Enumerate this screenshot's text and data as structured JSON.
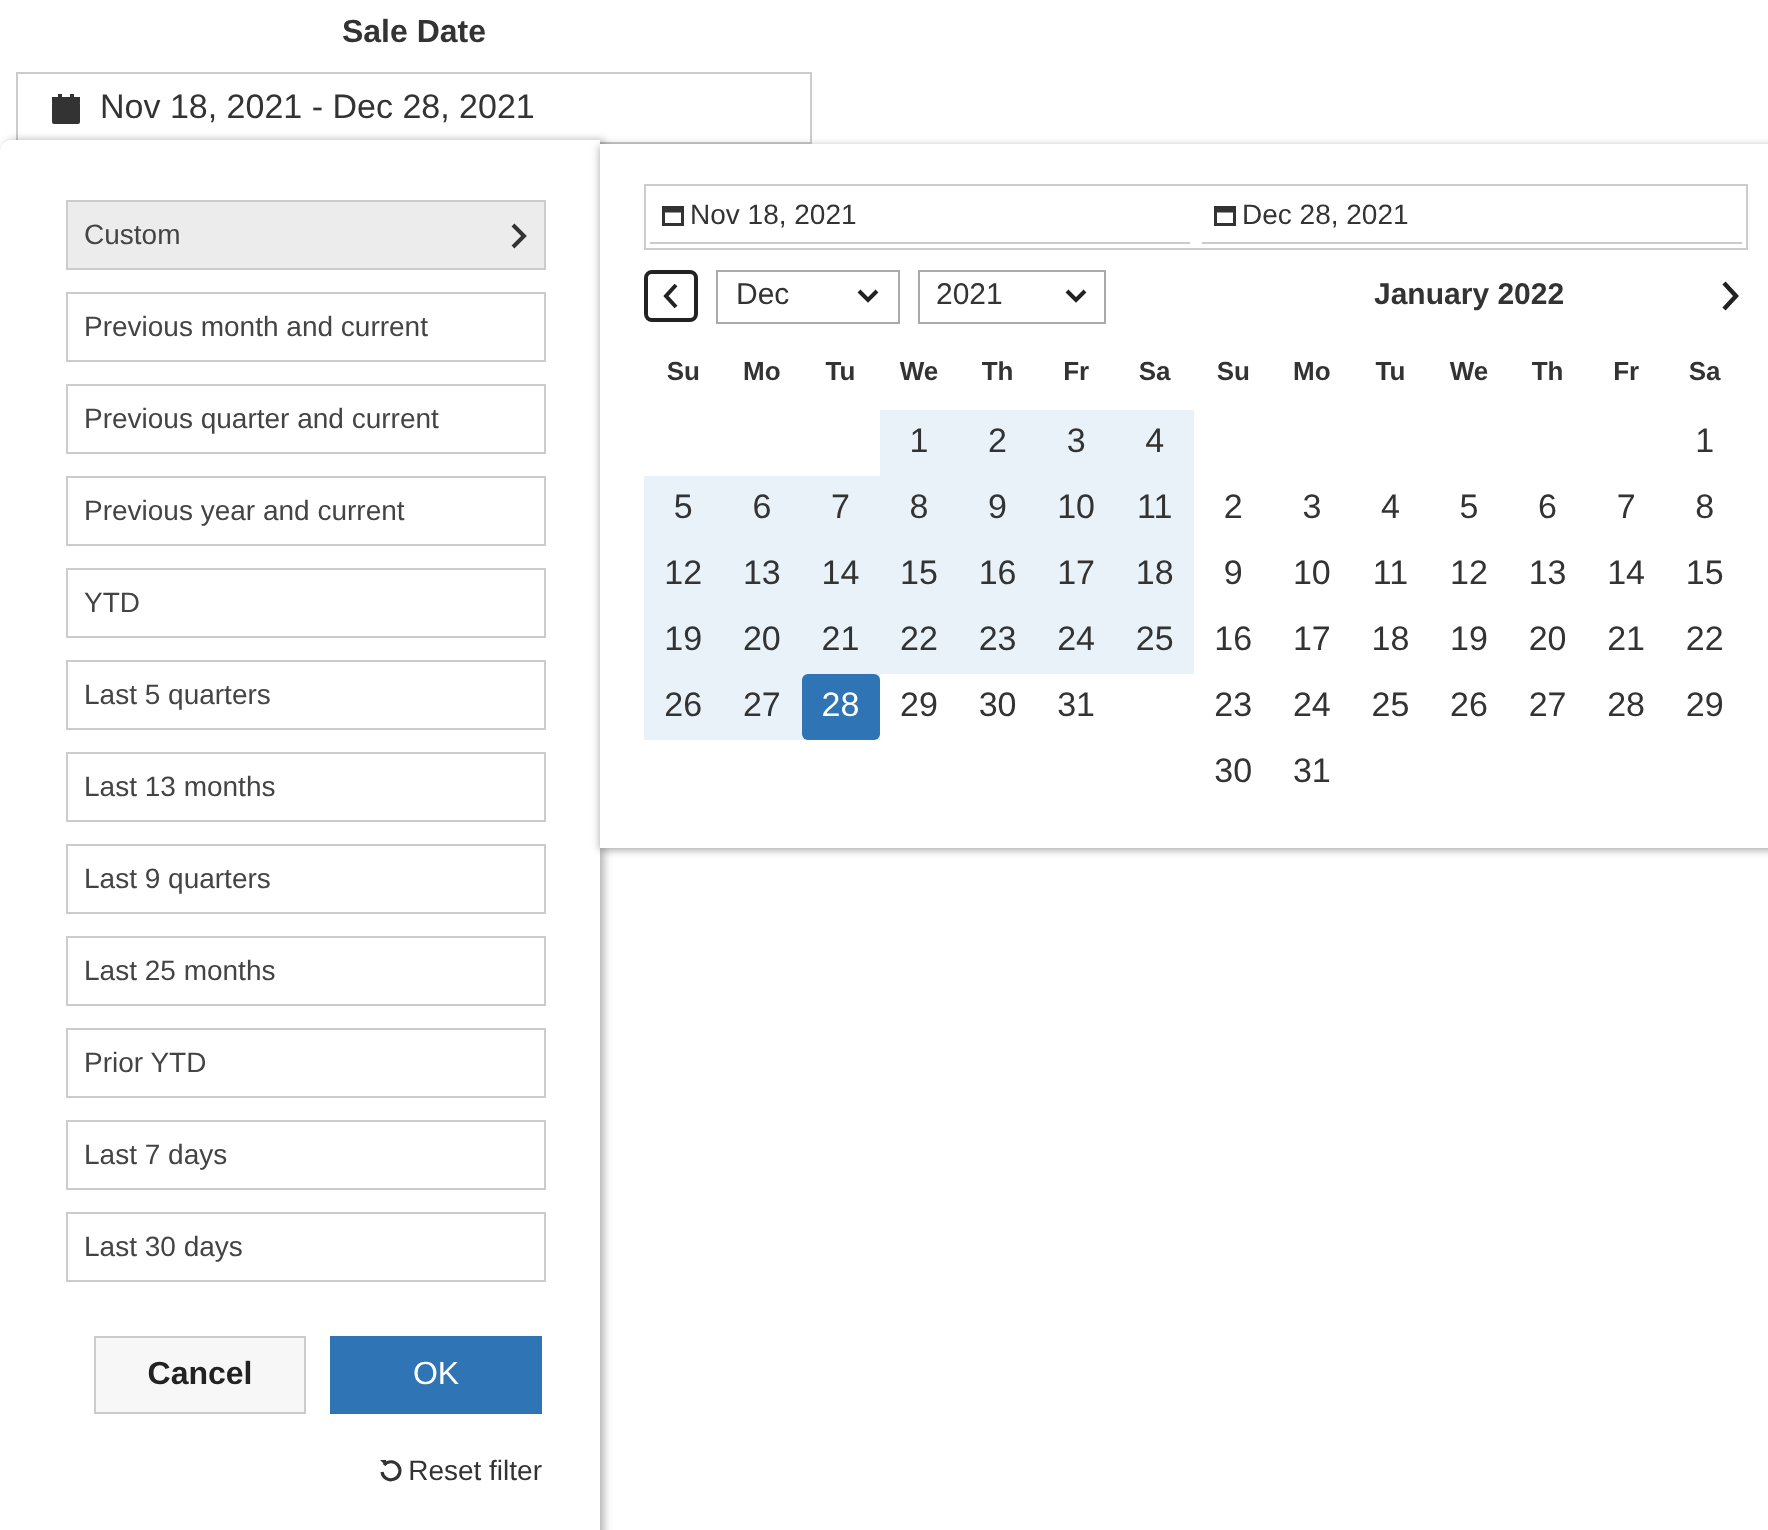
{
  "filter": {
    "title": "Sale Date",
    "value": "Nov 18, 2021 - Dec 28, 2021"
  },
  "presets": [
    {
      "label": "Custom",
      "selected": true
    },
    {
      "label": "Previous month and current",
      "selected": false
    },
    {
      "label": "Previous quarter and current",
      "selected": false
    },
    {
      "label": "Previous year and current",
      "selected": false
    },
    {
      "label": "YTD",
      "selected": false
    },
    {
      "label": "Last 5 quarters",
      "selected": false
    },
    {
      "label": "Last 13 months",
      "selected": false
    },
    {
      "label": "Last 9 quarters",
      "selected": false
    },
    {
      "label": "Last 25 months",
      "selected": false
    },
    {
      "label": "Prior YTD",
      "selected": false
    },
    {
      "label": "Last 7 days",
      "selected": false
    },
    {
      "label": "Last 30 days",
      "selected": false
    }
  ],
  "buttons": {
    "cancel": "Cancel",
    "ok": "OK",
    "reset": "Reset filter"
  },
  "range": {
    "start": "Nov 18, 2021",
    "end": "Dec 28, 2021"
  },
  "months": [
    {
      "month_select": "Dec",
      "year_select": "2021",
      "weekdays": [
        "Su",
        "Mo",
        "Tu",
        "We",
        "Th",
        "Fr",
        "Sa"
      ],
      "weeks": [
        [
          {
            "kind": "blank"
          },
          {
            "kind": "blank"
          },
          {
            "kind": "blank"
          },
          {
            "kind": "day",
            "d": "1",
            "in_range": true,
            "selected": false
          },
          {
            "kind": "day",
            "d": "2",
            "in_range": true,
            "selected": false
          },
          {
            "kind": "day",
            "d": "3",
            "in_range": true,
            "selected": false
          },
          {
            "kind": "day",
            "d": "4",
            "in_range": true,
            "selected": false
          }
        ],
        [
          {
            "kind": "day",
            "d": "5",
            "in_range": true,
            "selected": false
          },
          {
            "kind": "day",
            "d": "6",
            "in_range": true,
            "selected": false
          },
          {
            "kind": "day",
            "d": "7",
            "in_range": true,
            "selected": false
          },
          {
            "kind": "day",
            "d": "8",
            "in_range": true,
            "selected": false
          },
          {
            "kind": "day",
            "d": "9",
            "in_range": true,
            "selected": false
          },
          {
            "kind": "day",
            "d": "10",
            "in_range": true,
            "selected": false
          },
          {
            "kind": "day",
            "d": "11",
            "in_range": true,
            "selected": false
          }
        ],
        [
          {
            "kind": "day",
            "d": "12",
            "in_range": true,
            "selected": false
          },
          {
            "kind": "day",
            "d": "13",
            "in_range": true,
            "selected": false
          },
          {
            "kind": "day",
            "d": "14",
            "in_range": true,
            "selected": false
          },
          {
            "kind": "day",
            "d": "15",
            "in_range": true,
            "selected": false
          },
          {
            "kind": "day",
            "d": "16",
            "in_range": true,
            "selected": false
          },
          {
            "kind": "day",
            "d": "17",
            "in_range": true,
            "selected": false
          },
          {
            "kind": "day",
            "d": "18",
            "in_range": true,
            "selected": false
          }
        ],
        [
          {
            "kind": "day",
            "d": "19",
            "in_range": true,
            "selected": false
          },
          {
            "kind": "day",
            "d": "20",
            "in_range": true,
            "selected": false
          },
          {
            "kind": "day",
            "d": "21",
            "in_range": true,
            "selected": false
          },
          {
            "kind": "day",
            "d": "22",
            "in_range": true,
            "selected": false
          },
          {
            "kind": "day",
            "d": "23",
            "in_range": true,
            "selected": false
          },
          {
            "kind": "day",
            "d": "24",
            "in_range": true,
            "selected": false
          },
          {
            "kind": "day",
            "d": "25",
            "in_range": true,
            "selected": false
          }
        ],
        [
          {
            "kind": "day",
            "d": "26",
            "in_range": true,
            "selected": false
          },
          {
            "kind": "day",
            "d": "27",
            "in_range": true,
            "selected": false
          },
          {
            "kind": "day",
            "d": "28",
            "in_range": true,
            "selected": true
          },
          {
            "kind": "day",
            "d": "29",
            "in_range": false,
            "selected": false
          },
          {
            "kind": "day",
            "d": "30",
            "in_range": false,
            "selected": false
          },
          {
            "kind": "day",
            "d": "31",
            "in_range": false,
            "selected": false
          },
          {
            "kind": "blank"
          }
        ]
      ]
    },
    {
      "title": "January 2022",
      "weekdays": [
        "Su",
        "Mo",
        "Tu",
        "We",
        "Th",
        "Fr",
        "Sa"
      ],
      "weeks": [
        [
          {
            "kind": "blank"
          },
          {
            "kind": "blank"
          },
          {
            "kind": "blank"
          },
          {
            "kind": "blank"
          },
          {
            "kind": "blank"
          },
          {
            "kind": "blank"
          },
          {
            "kind": "day",
            "d": "1",
            "in_range": false,
            "selected": false
          }
        ],
        [
          {
            "kind": "day",
            "d": "2",
            "in_range": false,
            "selected": false
          },
          {
            "kind": "day",
            "d": "3",
            "in_range": false,
            "selected": false
          },
          {
            "kind": "day",
            "d": "4",
            "in_range": false,
            "selected": false
          },
          {
            "kind": "day",
            "d": "5",
            "in_range": false,
            "selected": false
          },
          {
            "kind": "day",
            "d": "6",
            "in_range": false,
            "selected": false
          },
          {
            "kind": "day",
            "d": "7",
            "in_range": false,
            "selected": false
          },
          {
            "kind": "day",
            "d": "8",
            "in_range": false,
            "selected": false
          }
        ],
        [
          {
            "kind": "day",
            "d": "9",
            "in_range": false,
            "selected": false
          },
          {
            "kind": "day",
            "d": "10",
            "in_range": false,
            "selected": false
          },
          {
            "kind": "day",
            "d": "11",
            "in_range": false,
            "selected": false
          },
          {
            "kind": "day",
            "d": "12",
            "in_range": false,
            "selected": false
          },
          {
            "kind": "day",
            "d": "13",
            "in_range": false,
            "selected": false
          },
          {
            "kind": "day",
            "d": "14",
            "in_range": false,
            "selected": false
          },
          {
            "kind": "day",
            "d": "15",
            "in_range": false,
            "selected": false
          }
        ],
        [
          {
            "kind": "day",
            "d": "16",
            "in_range": false,
            "selected": false
          },
          {
            "kind": "day",
            "d": "17",
            "in_range": false,
            "selected": false
          },
          {
            "kind": "day",
            "d": "18",
            "in_range": false,
            "selected": false
          },
          {
            "kind": "day",
            "d": "19",
            "in_range": false,
            "selected": false
          },
          {
            "kind": "day",
            "d": "20",
            "in_range": false,
            "selected": false
          },
          {
            "kind": "day",
            "d": "21",
            "in_range": false,
            "selected": false
          },
          {
            "kind": "day",
            "d": "22",
            "in_range": false,
            "selected": false
          }
        ],
        [
          {
            "kind": "day",
            "d": "23",
            "in_range": false,
            "selected": false
          },
          {
            "kind": "day",
            "d": "24",
            "in_range": false,
            "selected": false
          },
          {
            "kind": "day",
            "d": "25",
            "in_range": false,
            "selected": false
          },
          {
            "kind": "day",
            "d": "26",
            "in_range": false,
            "selected": false
          },
          {
            "kind": "day",
            "d": "27",
            "in_range": false,
            "selected": false
          },
          {
            "kind": "day",
            "d": "28",
            "in_range": false,
            "selected": false
          },
          {
            "kind": "day",
            "d": "29",
            "in_range": false,
            "selected": false
          }
        ],
        [
          {
            "kind": "day",
            "d": "30",
            "in_range": false,
            "selected": false
          },
          {
            "kind": "day",
            "d": "31",
            "in_range": false,
            "selected": false
          },
          {
            "kind": "blank"
          },
          {
            "kind": "blank"
          },
          {
            "kind": "blank"
          },
          {
            "kind": "blank"
          },
          {
            "kind": "blank"
          }
        ]
      ]
    }
  ]
}
